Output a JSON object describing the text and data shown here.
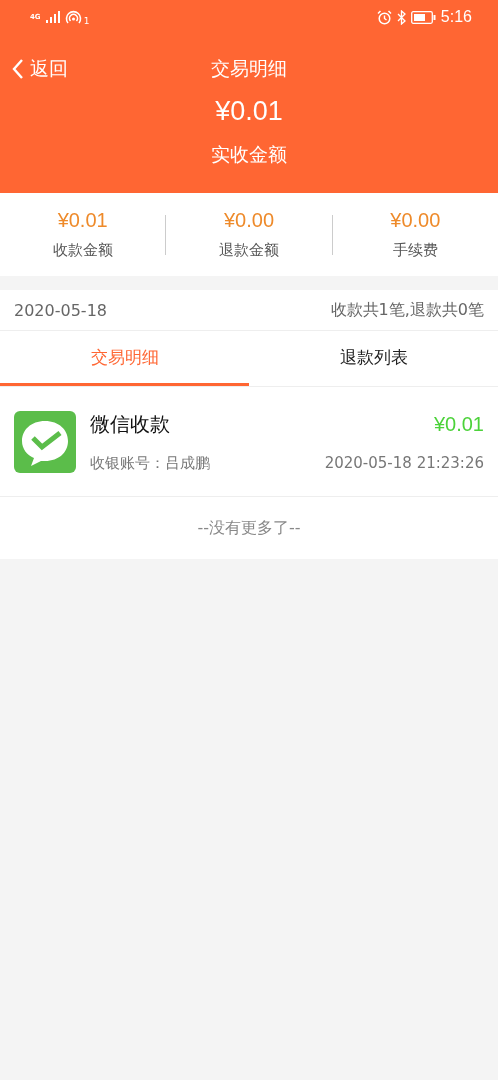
{
  "status_bar": {
    "network": "4G",
    "hotspot_count": "1",
    "time": "5:16"
  },
  "nav": {
    "back": "返回",
    "title": "交易明细"
  },
  "header": {
    "amount": "¥0.01",
    "label": "实收金额"
  },
  "summary": [
    {
      "value": "¥0.01",
      "label": "收款金额"
    },
    {
      "value": "¥0.00",
      "label": "退款金额"
    },
    {
      "value": "¥0.00",
      "label": "手续费"
    }
  ],
  "date_bar": {
    "date": "2020-05-18",
    "counts": "收款共1笔,退款共0笔"
  },
  "tabs": [
    {
      "label": "交易明细",
      "selected": true
    },
    {
      "label": "退款列表",
      "selected": false
    }
  ],
  "transactions": [
    {
      "kind": "wechat",
      "title": "微信收款",
      "amount": "¥0.01",
      "cashier": "收银账号：吕成鹏",
      "time": "2020-05-18 21:23:26"
    }
  ],
  "footer_note": "--没有更多了--"
}
